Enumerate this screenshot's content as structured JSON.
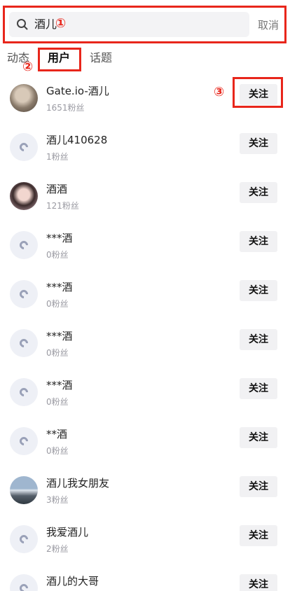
{
  "search": {
    "query": "酒儿",
    "cancel_label": "取消"
  },
  "annotations": {
    "a1": "①",
    "a2": "②",
    "a3": "③"
  },
  "tabs": [
    {
      "label": "动态"
    },
    {
      "label": "用户"
    },
    {
      "label": "话题"
    }
  ],
  "follow_label": "关注",
  "users": [
    {
      "name": "Gate.io-酒儿",
      "fans": "1651粉丝"
    },
    {
      "name": "酒儿410628",
      "fans": "1粉丝"
    },
    {
      "name": "酒酒",
      "fans": "121粉丝"
    },
    {
      "name": "***酒",
      "fans": "0粉丝"
    },
    {
      "name": "***酒",
      "fans": "0粉丝"
    },
    {
      "name": "***酒",
      "fans": "0粉丝"
    },
    {
      "name": "***酒",
      "fans": "0粉丝"
    },
    {
      "name": "**酒",
      "fans": "0粉丝"
    },
    {
      "name": "酒儿我女朋友",
      "fans": "3粉丝"
    },
    {
      "name": "我爱酒儿",
      "fans": "2粉丝"
    },
    {
      "name": "酒儿的大哥",
      "fans": ""
    }
  ]
}
